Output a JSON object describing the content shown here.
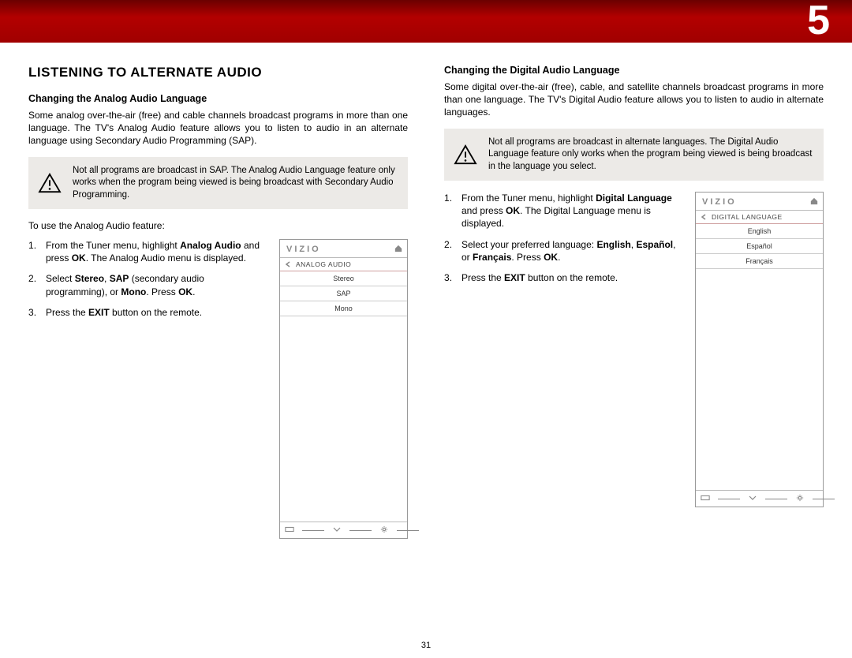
{
  "chapter": "5",
  "page_number": "31",
  "left": {
    "h1": "LISTENING TO ALTERNATE AUDIO",
    "h2": "Changing the Analog Audio Language",
    "intro": "Some analog over-the-air (free) and cable channels broadcast programs in more than one language. The TV's Analog Audio feature allows you to listen to audio in an alternate language using Secondary Audio Programming (SAP).",
    "warn": "Not all programs are broadcast in SAP. The Analog Audio Language feature only works when the program being viewed is being broadcast with Secondary Audio Programming.",
    "lead": "To use the Analog Audio feature:",
    "step1_a": "From the Tuner menu, highlight ",
    "step1_b": "Analog Audio",
    "step1_c": " and press ",
    "step1_d": "OK",
    "step1_e": ". The Analog Audio menu is displayed.",
    "step2_a": "Select ",
    "step2_b": "Stereo",
    "step2_c": ", ",
    "step2_d": "SAP",
    "step2_e": " (secondary audio programming), or ",
    "step2_f": "Mono",
    "step2_g": ". Press ",
    "step2_h": "OK",
    "step2_i": ".",
    "step3_a": "Press the ",
    "step3_b": "EXIT",
    "step3_c": " button on the remote.",
    "osd": {
      "brand": "VIZIO",
      "title": "ANALOG AUDIO",
      "items": [
        "Stereo",
        "SAP",
        "Mono"
      ]
    }
  },
  "right": {
    "h2": "Changing the Digital Audio Language",
    "intro": "Some digital over-the-air (free), cable, and satellite channels broadcast programs in more than one language. The TV's Digital Audio feature allows you to listen to audio in alternate languages.",
    "warn": "Not all programs are broadcast in alternate languages. The Digital Audio Language feature only works when the program being viewed is being broadcast in the language you select.",
    "step1_a": "From the Tuner menu, highlight ",
    "step1_b": "Digital Language",
    "step1_c": " and press ",
    "step1_d": "OK",
    "step1_e": ". The Digital Language menu is displayed.",
    "step2_a": "Select your preferred language: ",
    "step2_b": "English",
    "step2_c": ", ",
    "step2_d": "Español",
    "step2_e": ", or ",
    "step2_f": "Français",
    "step2_g": ". Press ",
    "step2_h": "OK",
    "step2_i": ".",
    "step3_a": "Press the ",
    "step3_b": "EXIT",
    "step3_c": " button on the remote.",
    "osd": {
      "brand": "VIZIO",
      "title": "DIGITAL LANGUAGE",
      "items": [
        "English",
        "Español",
        "Français"
      ]
    }
  }
}
